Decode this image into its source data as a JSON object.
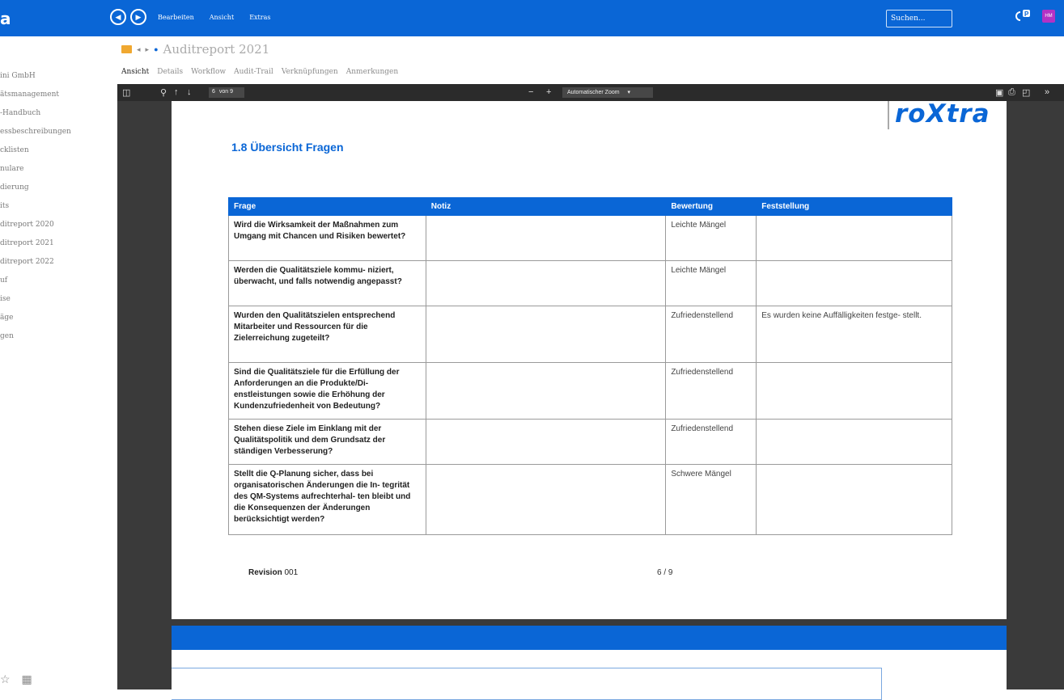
{
  "app": {
    "brand": "a",
    "menu": [
      "Bearbeiten",
      "Ansicht",
      "Extras"
    ],
    "search_placeholder": "Suchen...",
    "user_initials": "HM",
    "colors": {
      "accent": "#0a66d6",
      "avatar": "#b332c5"
    }
  },
  "sidebar": {
    "items": [
      {
        "label": "ini GmbH"
      },
      {
        "label": "ätsmanagement"
      },
      {
        "label": "-Handbuch"
      },
      {
        "label": "essbeschreibungen"
      },
      {
        "label": "cklisten"
      },
      {
        "label": "nulare"
      },
      {
        "label": "dierung"
      },
      {
        "label": "its"
      },
      {
        "label": "ditreport 2020"
      },
      {
        "label": "ditreport 2021"
      },
      {
        "label": "ditreport 2022"
      },
      {
        "label": "uf"
      },
      {
        "label": "ise"
      },
      {
        "label": "äge"
      },
      {
        "label": "gen"
      }
    ]
  },
  "document": {
    "title": "Auditreport 2021",
    "tabs": [
      "Ansicht",
      "Details",
      "Workflow",
      "Audit-Trail",
      "Verknüpfungen",
      "Anmerkungen"
    ],
    "active_tab": "Ansicht"
  },
  "viewer": {
    "page_number": "6",
    "page_of": "von 9",
    "zoom_label": "Automatischer Zoom"
  },
  "page": {
    "logo": "roXtra",
    "section_title": "1.8  Übersicht Fragen",
    "table": {
      "headers": [
        "Frage",
        "Notiz",
        "Bewertung",
        "Feststellung"
      ],
      "rows": [
        {
          "frage": "Wird die Wirksamkeit der Maßnahmen zum Umgang mit Chancen und Risiken bewertet?",
          "notiz": "",
          "bewertung": "Leichte Mängel",
          "feststellung": ""
        },
        {
          "frage": "Werden die Qualitätsziele kommu- niziert, überwacht, und falls notwendig angepasst?",
          "notiz": "",
          "bewertung": "Leichte Mängel",
          "feststellung": ""
        },
        {
          "frage": "Wurden den Qualitätszielen entsprechend Mitarbeiter und Ressourcen für die Zielerreichung zugeteilt?",
          "notiz": "",
          "bewertung": "Zufriedenstellend",
          "feststellung": "Es wurden keine Auffälligkeiten festge- stellt."
        },
        {
          "frage": "Sind die Qualitätsziele für die Erfüllung der Anforderungen an die Produkte/Di- enstleistungen sowie die Erhöhung der Kundenzufriedenheit von Bedeutung?",
          "notiz": "",
          "bewertung": "Zufriedenstellend",
          "feststellung": ""
        },
        {
          "frage": "Stehen diese Ziele im Einklang mit der Qualitätspolitik und dem Grundsatz der ständigen Verbesserung?",
          "notiz": "",
          "bewertung": "Zufriedenstellend",
          "feststellung": ""
        },
        {
          "frage": "Stellt die Q-Planung sicher, dass bei organisatorischen Änderungen die In- tegrität des QM-Systems aufrechterhal- ten bleibt und die Konsequenzen der Änderungen berücksichtigt werden?",
          "notiz": "",
          "bewertung": "Schwere Mängel",
          "feststellung": ""
        }
      ]
    },
    "footer": {
      "revision_label": "Revision",
      "revision_value": "001",
      "page_counter": "6 / 9"
    }
  }
}
